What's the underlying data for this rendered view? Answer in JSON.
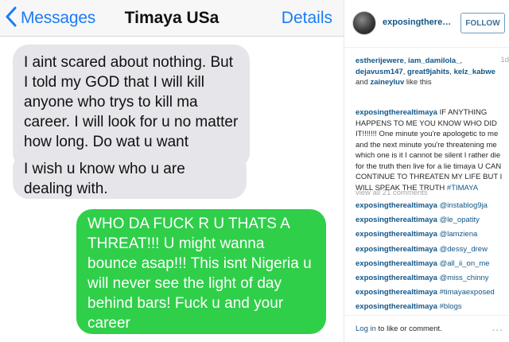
{
  "sms": {
    "back_label": "Messages",
    "contact": "Timaya USa",
    "details_label": "Details",
    "messages": [
      {
        "direction": "incoming",
        "text": "I aint scared about nothing. But I told my GOD that I will kill anyone who trys to kill ma career. I will look for u no matter how long. Do wat u want"
      },
      {
        "direction": "incoming",
        "text": "I wish u know who u are dealing with."
      },
      {
        "direction": "outgoing",
        "text": "WHO DA FUCK R U THATS A THREAT!!! U might wanna bounce asap!!! This isnt Nigeria u will never see the light of day behind bars! Fuck u and your career"
      }
    ]
  },
  "instagram": {
    "username": "exposingtherealti...",
    "follow_label": "FOLLOW",
    "time_ago": "1d",
    "likes": {
      "users": [
        "estherijewere",
        "iam_damilola_",
        "dejavusm147",
        "great9jahits",
        "kelz_kabwe",
        "zaineyluv"
      ],
      "sep_comma": ", ",
      "sep_and": " and ",
      "suffix": " like this"
    },
    "caption": {
      "user": "exposingtherealtimaya",
      "text": "IF ANYTHING HAPPENS TO ME YOU KNOW WHO DID IT!!!!!!! One minute you're apologetic to me and the next minute you're threatening me which one is it I cannot be silent I rather die for the truth then live for a lie timaya U CAN CONTINUE TO THREATEN MY LIFE BUT I WILL SPEAK THE TRUTH",
      "hashtag": "#TIMAYA"
    },
    "view_all": "view all 21 comments",
    "comments": [
      {
        "user": "exposingtherealtimaya",
        "text": "@instablog9ja"
      },
      {
        "user": "exposingtherealtimaya",
        "text": "@le_opatity"
      },
      {
        "user": "exposingtherealtimaya",
        "text": "@lamziena"
      },
      {
        "user": "exposingtherealtimaya",
        "text": "@dessy_drew"
      },
      {
        "user": "exposingtherealtimaya",
        "text": "@all_ii_on_me"
      },
      {
        "user": "exposingtherealtimaya",
        "text": "@miss_chinny"
      },
      {
        "user": "exposingtherealtimaya",
        "text": "#timayaexposed"
      },
      {
        "user": "exposingtherealtimaya",
        "text": "#blogs"
      }
    ],
    "login": {
      "link": "Log in",
      "rest": " to like or comment."
    },
    "more_label": "..."
  },
  "colors": {
    "ios_blue": "#1a7cf5",
    "incoming_bubble": "#e5e5ea",
    "outgoing_bubble": "#2fcf4a",
    "ig_link_blue": "#125688"
  },
  "icons": {
    "back": "chevron-left-icon"
  }
}
